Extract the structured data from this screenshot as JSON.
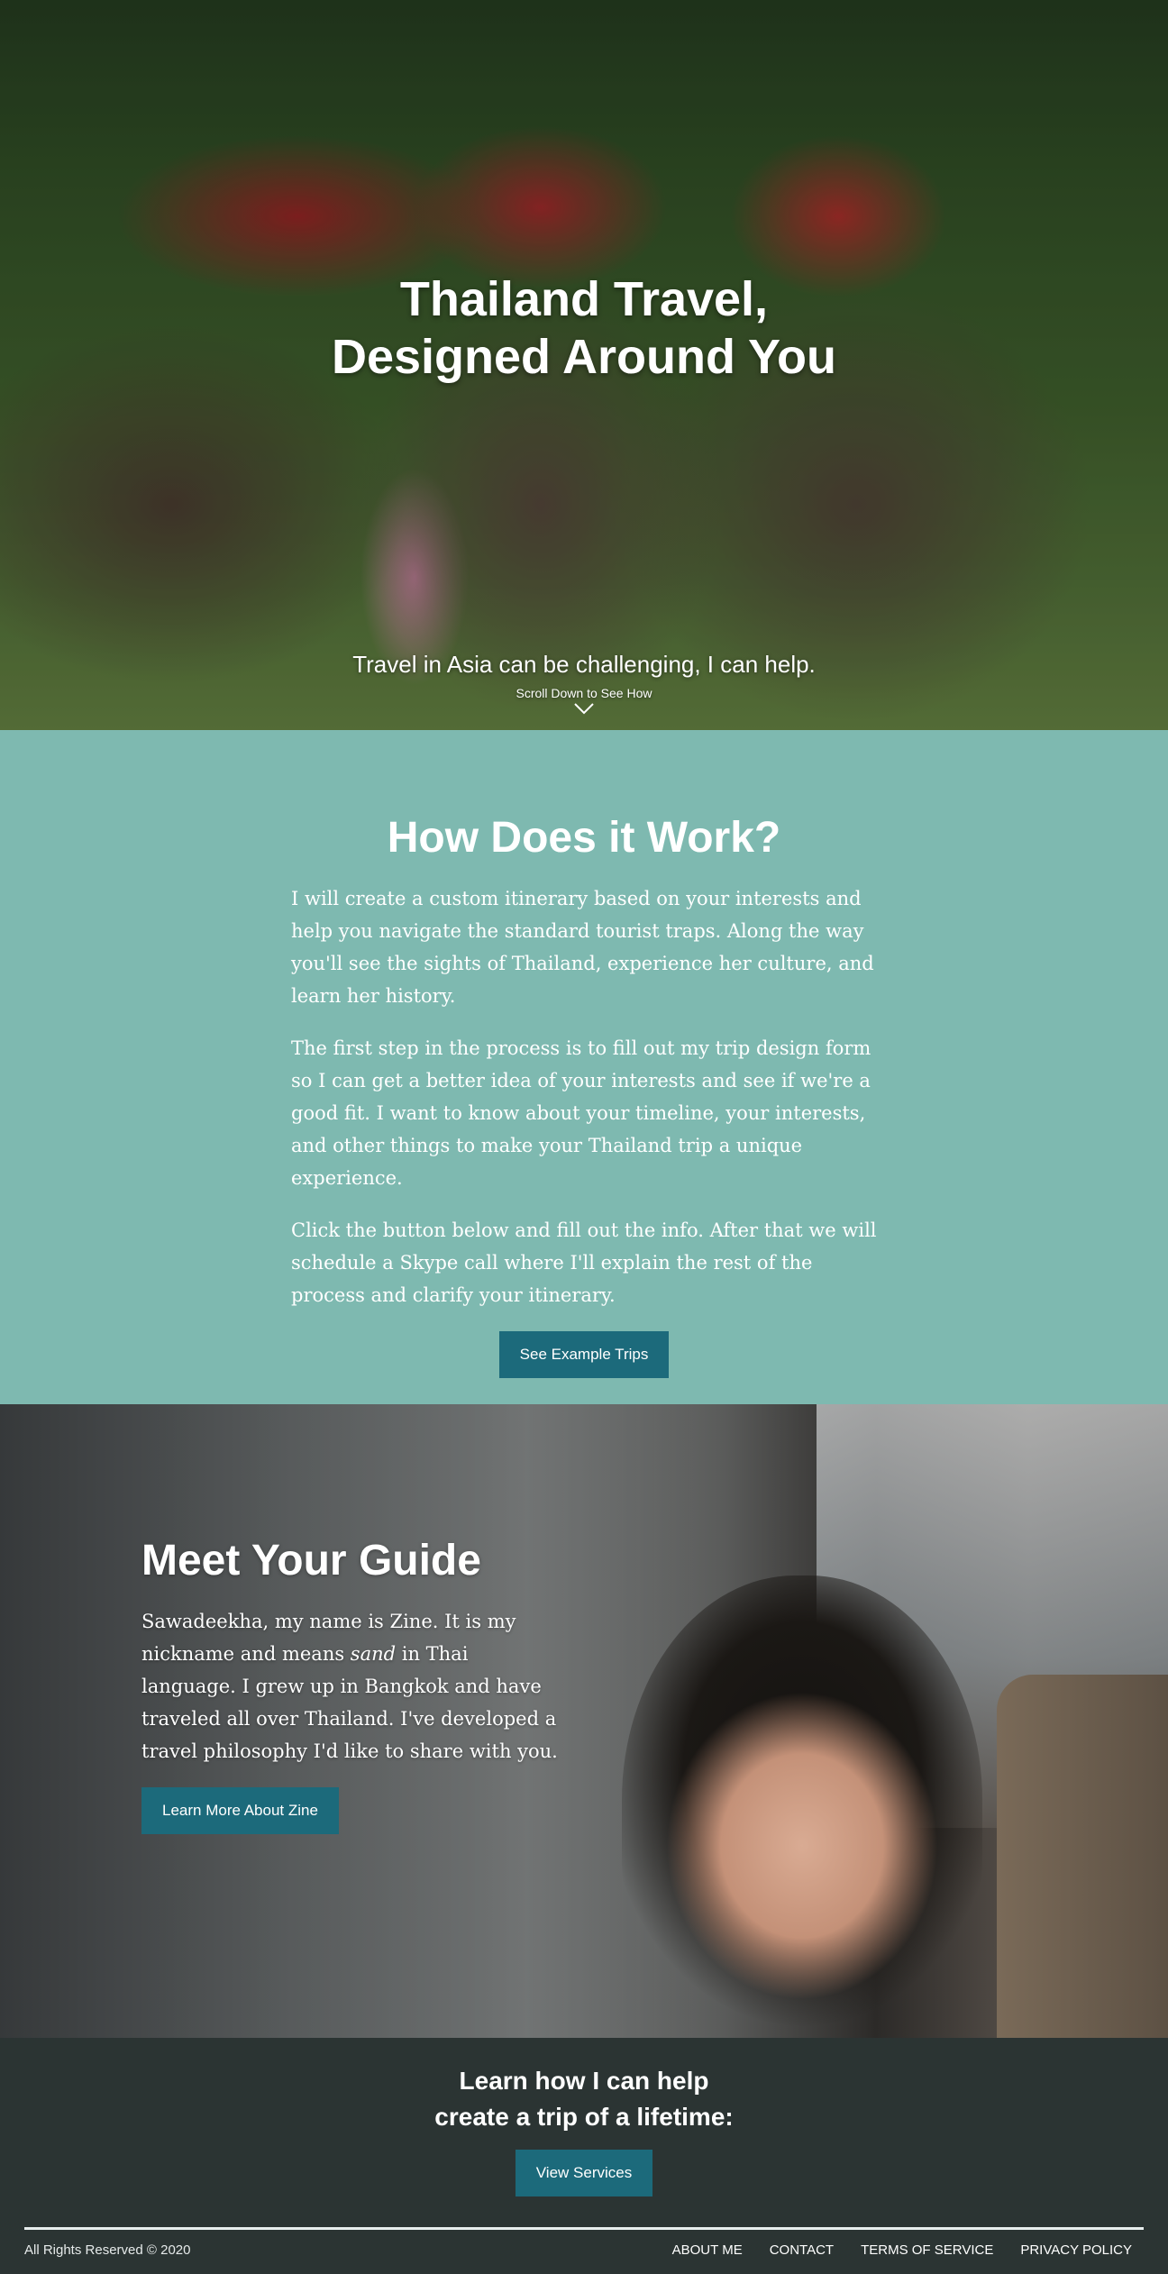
{
  "hero": {
    "title": "Thailand Travel,\nDesigned Around You",
    "subtitle": "Travel in Asia can be challenging, I can help.",
    "scroll_text": "Scroll Down to See How",
    "scroll_icon": "chevron-down-icon"
  },
  "how": {
    "heading": "How Does it Work?",
    "paragraphs": [
      "I will create a custom itinerary based on your interests and help you navigate the standard tourist traps. Along the way you'll see the sights of Thailand, experience her culture, and learn her history.",
      "The first step in the process is to fill out my trip design form so I can get a better idea of your interests and see if we're a good fit. I want to know about your timeline, your interests, and other things to make your Thailand trip a unique experience.",
      "Click the button below and fill out the info. After that we will schedule a Skype call where I'll explain the rest of the process and clarify your itinerary."
    ],
    "button_label": "See Example Trips"
  },
  "guide": {
    "heading": "Meet Your Guide",
    "text_before": "Sawadeekha, my name is Zine. It is my nickname and means ",
    "text_em": "sand",
    "text_after": " in Thai language. I grew up in Bangkok and have traveled all over Thailand. I've developed a travel philosophy I'd like to share with you.",
    "button_label": "Learn More About Zine"
  },
  "cta": {
    "heading": "Learn how I can help\ncreate a trip of a lifetime:",
    "button_label": "View Services"
  },
  "footer": {
    "copyright": "All Rights Reserved © 2020",
    "links": [
      "About Me",
      "Contact",
      "Terms of Service",
      "Privacy Policy"
    ]
  },
  "colors": {
    "teal_section": "#7eb9b0",
    "button": "#1c6a7b",
    "dark": "#2b3433"
  }
}
